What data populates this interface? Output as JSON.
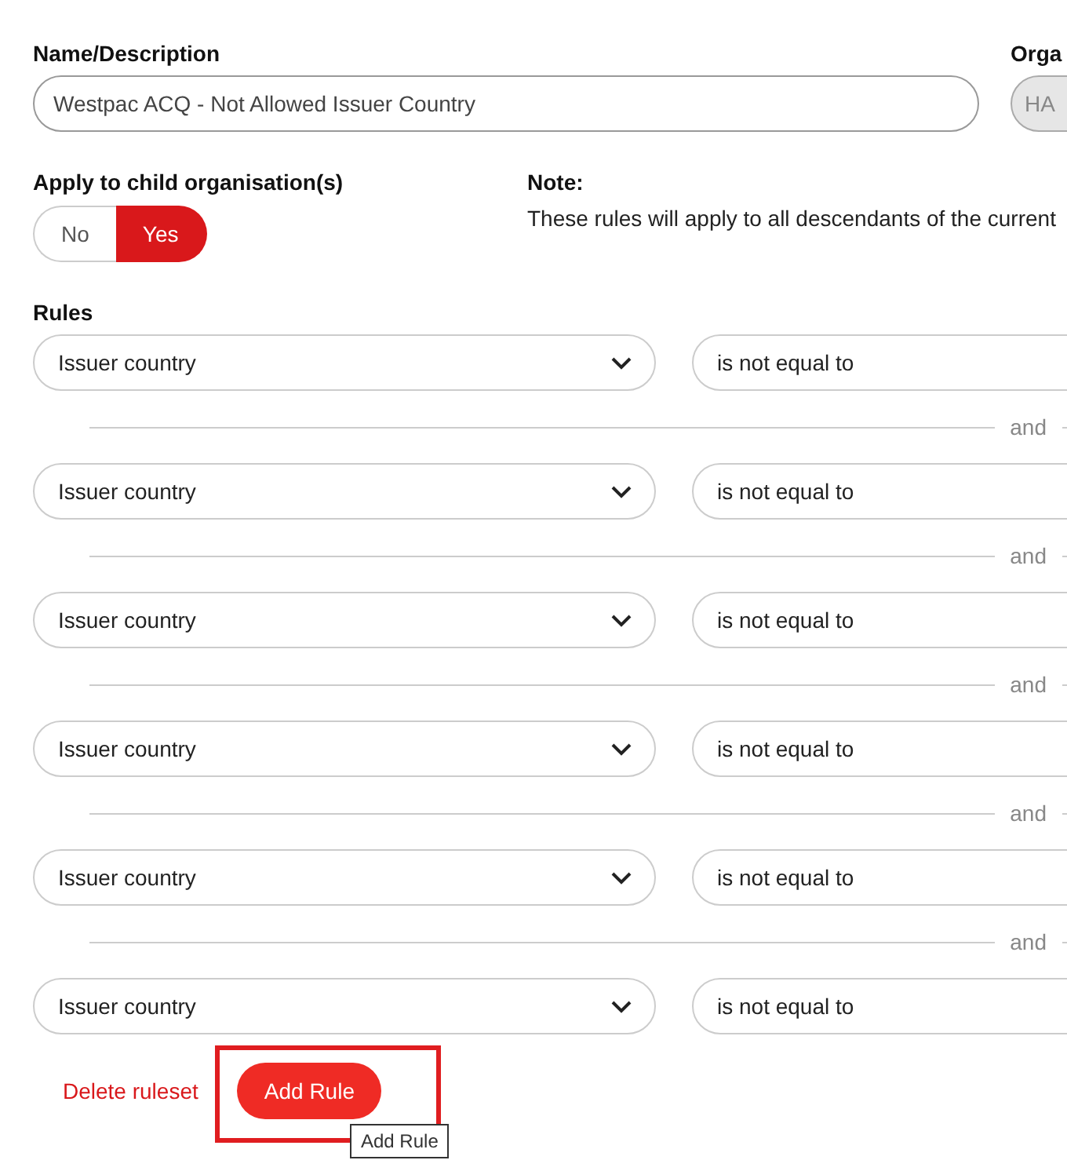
{
  "name_field": {
    "label": "Name/Description",
    "value": "Westpac ACQ - Not Allowed Issuer Country"
  },
  "organisation_field": {
    "label": "Orga",
    "value": "HA"
  },
  "apply_to_child": {
    "label": "Apply to child organisation(s)",
    "options": [
      {
        "label": "No",
        "selected": false
      },
      {
        "label": "Yes",
        "selected": true
      }
    ]
  },
  "note": {
    "title": "Note:",
    "text": "These rules will apply to all descendants of the current"
  },
  "rules": {
    "label": "Rules",
    "items": [
      {
        "field": "Issuer country",
        "operator": "is not equal to",
        "connector": "and"
      },
      {
        "field": "Issuer country",
        "operator": "is not equal to",
        "connector": "and"
      },
      {
        "field": "Issuer country",
        "operator": "is not equal to",
        "connector": "and"
      },
      {
        "field": "Issuer country",
        "operator": "is not equal to",
        "connector": "and"
      },
      {
        "field": "Issuer country",
        "operator": "is not equal to",
        "connector": "and"
      },
      {
        "field": "Issuer country",
        "operator": "is not equal to"
      }
    ]
  },
  "actions": {
    "delete": "Delete ruleset",
    "add": "Add Rule",
    "tooltip": "Add Rule",
    "highlighted": true
  }
}
